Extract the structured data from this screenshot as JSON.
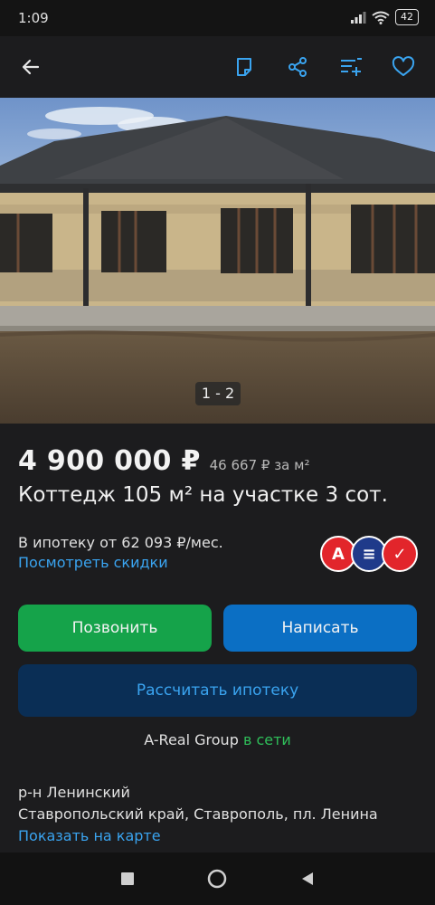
{
  "status_bar": {
    "time": "1:09",
    "battery": "42"
  },
  "photo": {
    "counter": "1 - 2"
  },
  "listing": {
    "price": "4 900 000 ₽",
    "price_per_m2": "46 667 ₽ за м²",
    "title": "Коттедж 105 м² на участке 3 сот."
  },
  "mortgage": {
    "text": "В ипотеку от 62 093 ₽/мес.",
    "discounts_link": "Посмотреть скидки"
  },
  "banks": [
    {
      "icon": "alfa-bank-logo",
      "letter": "А",
      "color": "#e2252b"
    },
    {
      "icon": "domrf-bank-logo",
      "letter": "≡",
      "color": "#1f3a8a"
    },
    {
      "icon": "vtb-bank-logo",
      "letter": "✓",
      "color": "#e2252b"
    }
  ],
  "buttons": {
    "call": "Позвонить",
    "message": "Написать",
    "calc_mortgage": "Рассчитать ипотеку"
  },
  "seller": {
    "name": "A-Real Group",
    "status": "в сети"
  },
  "location": {
    "district": "р-н Ленинский",
    "address": "Ставропольский край, Ставрополь, пл. Ленина",
    "map_link": "Показать на карте"
  },
  "colors": {
    "accent": "#3aa4f0",
    "call": "#15a34a",
    "message": "#0b6fc4",
    "online": "#2fbf5a"
  }
}
